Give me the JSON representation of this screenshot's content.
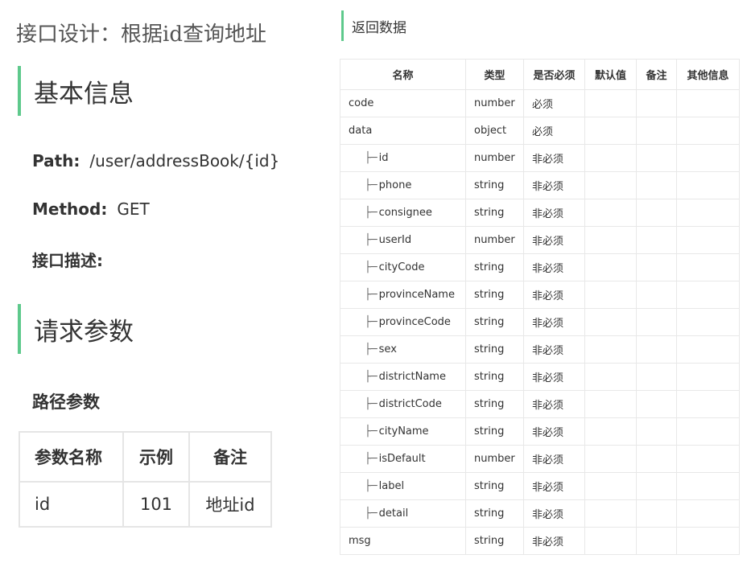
{
  "doc_title": "接口设计：根据id查询地址",
  "basic_info": {
    "heading": "基本信息",
    "path_label": "Path",
    "path_value": "/user/addressBook/{id}",
    "method_label": "Method",
    "method_value": "GET",
    "desc_label": "接口描述:"
  },
  "request": {
    "heading": "请求参数",
    "path_params_heading": "路径参数",
    "columns": [
      "参数名称",
      "示例",
      "备注"
    ],
    "rows": [
      [
        "id",
        "101",
        "地址id"
      ]
    ]
  },
  "response": {
    "heading": "返回数据",
    "columns": [
      "名称",
      "类型",
      "是否必须",
      "默认值",
      "备注",
      "其他信息"
    ],
    "rows": [
      {
        "name": "code",
        "child": false,
        "type": "number",
        "required": "必须"
      },
      {
        "name": "data",
        "child": false,
        "type": "object",
        "required": "必须"
      },
      {
        "name": "id",
        "child": true,
        "type": "number",
        "required": "非必须"
      },
      {
        "name": "phone",
        "child": true,
        "type": "string",
        "required": "非必须"
      },
      {
        "name": "consignee",
        "child": true,
        "type": "string",
        "required": "非必须"
      },
      {
        "name": "userId",
        "child": true,
        "type": "number",
        "required": "非必须"
      },
      {
        "name": "cityCode",
        "child": true,
        "type": "string",
        "required": "非必须"
      },
      {
        "name": "provinceName",
        "child": true,
        "type": "string",
        "required": "非必须"
      },
      {
        "name": "provinceCode",
        "child": true,
        "type": "string",
        "required": "非必须"
      },
      {
        "name": "sex",
        "child": true,
        "type": "string",
        "required": "非必须"
      },
      {
        "name": "districtName",
        "child": true,
        "type": "string",
        "required": "非必须"
      },
      {
        "name": "districtCode",
        "child": true,
        "type": "string",
        "required": "非必须"
      },
      {
        "name": "cityName",
        "child": true,
        "type": "string",
        "required": "非必须"
      },
      {
        "name": "isDefault",
        "child": true,
        "type": "number",
        "required": "非必须"
      },
      {
        "name": "label",
        "child": true,
        "type": "string",
        "required": "非必须"
      },
      {
        "name": "detail",
        "child": true,
        "type": "string",
        "required": "非必须"
      },
      {
        "name": "msg",
        "child": false,
        "type": "string",
        "required": "非必须"
      }
    ]
  },
  "colors": {
    "accent": "#5ec98c",
    "border": "#e8e8e8",
    "text": "#333333"
  }
}
